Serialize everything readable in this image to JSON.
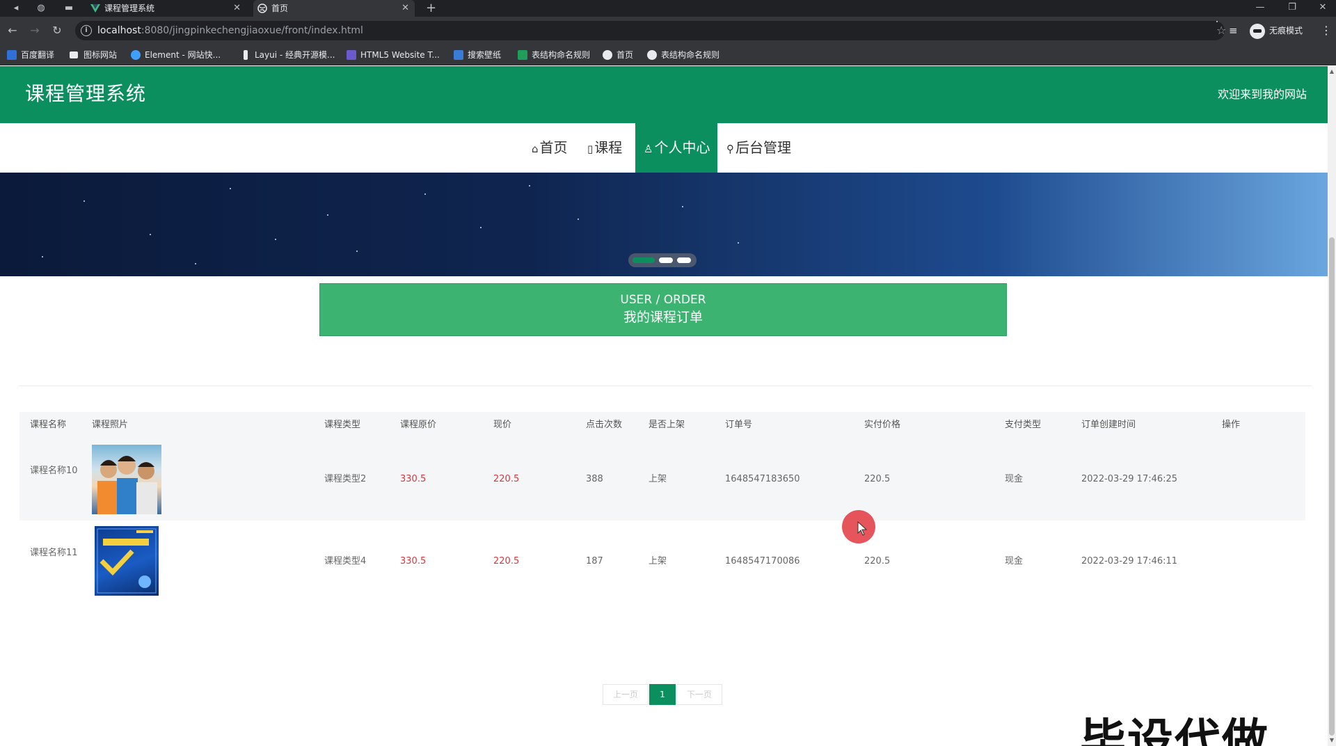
{
  "browser": {
    "tabs": [
      {
        "title": "课程管理系统",
        "active": false
      },
      {
        "title": "首页",
        "active": true
      }
    ],
    "url_host": "localhost",
    "url_rest": ":8080/jingpinkechengjiaoxue/front/index.html",
    "profile_label": "无痕模式",
    "bookmarks": [
      "百度翻译",
      "图标网站",
      "Element - 网站快...",
      "Layui - 经典开源模...",
      "HTML5 Website T...",
      "搜索壁纸",
      "表结构命名规则",
      "首页",
      "表结构命名规则"
    ]
  },
  "header": {
    "site_title": "课程管理系统",
    "welcome": "欢迎来到我的网站"
  },
  "nav": {
    "items": [
      {
        "label": "首页",
        "icon": "home-icon",
        "active": false
      },
      {
        "label": "课程",
        "icon": "book-icon",
        "active": false
      },
      {
        "label": "个人中心",
        "icon": "user-icon",
        "active": true
      },
      {
        "label": "后台管理",
        "icon": "link-icon",
        "active": false
      }
    ]
  },
  "carousel": {
    "slides": 3,
    "current": 1
  },
  "order_section": {
    "title_en": "USER / ORDER",
    "title_zh": "我的课程订单"
  },
  "table": {
    "headers": [
      "课程名称",
      "课程照片",
      "课程类型",
      "课程原价",
      "现价",
      "点击次数",
      "是否上架",
      "订单号",
      "实付价格",
      "支付类型",
      "订单创建时间",
      "操作"
    ],
    "rows": [
      {
        "name": "课程名称10",
        "photo": "children-photo",
        "type": "课程类型2",
        "original_price": "330.5",
        "price": "220.5",
        "clicks": "388",
        "listed": "上架",
        "order_no": "1648547183650",
        "paid": "220.5",
        "pay_type": "现金",
        "created": "2022-03-29 17:46:25",
        "action": ""
      },
      {
        "name": "课程名称11",
        "photo": "book-cover",
        "type": "课程类型4",
        "original_price": "330.5",
        "price": "220.5",
        "clicks": "187",
        "listed": "上架",
        "order_no": "1648547170086",
        "paid": "220.5",
        "pay_type": "现金",
        "created": "2022-03-29 17:46:11",
        "action": ""
      }
    ]
  },
  "pagination": {
    "prev": "上一页",
    "current": "1",
    "next": "下一页"
  },
  "watermark": "毕设代做",
  "colors": {
    "primary": "#0c8f5e",
    "order_bar": "#3cb371",
    "price_red": "#d9363e"
  }
}
